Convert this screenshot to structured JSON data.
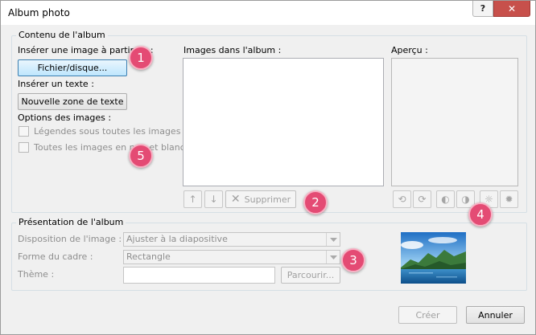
{
  "window": {
    "title": "Album photo",
    "help_label": "?",
    "close_label": "✕"
  },
  "album_content": {
    "group_label": "Contenu de l'album",
    "insert_image_label": "Insérer une image à partir de :",
    "file_button_label": "Fichier/disque...",
    "insert_text_label": "Insérer un texte :",
    "new_textbox_button_label": "Nouvelle zone de texte",
    "image_options_label": "Options des images :",
    "captions_option_label": "Légendes sous toutes les images",
    "bw_option_label": "Toutes les images en noir et blanc",
    "captions_checked": false,
    "bw_checked": false,
    "images_in_album_label": "Images dans l'album :",
    "delete_button_label": "Supprimer",
    "preview_label": "Aperçu :"
  },
  "album_layout": {
    "group_label": "Présentation de l'album",
    "picture_layout_label": "Disposition de l'image :",
    "picture_layout_value": "Ajuster à la diapositive",
    "frame_shape_label": "Forme du cadre :",
    "frame_shape_value": "Rectangle",
    "theme_label": "Thème :",
    "theme_value": "",
    "browse_button_label": "Parcourir..."
  },
  "footer": {
    "create_button_label": "Créer",
    "cancel_button_label": "Annuler"
  },
  "callouts": [
    "1",
    "2",
    "3",
    "4",
    "5"
  ],
  "colors": {
    "callout": "#e44b74",
    "close": "#c7504b",
    "focus_border": "#3c7fb1"
  }
}
